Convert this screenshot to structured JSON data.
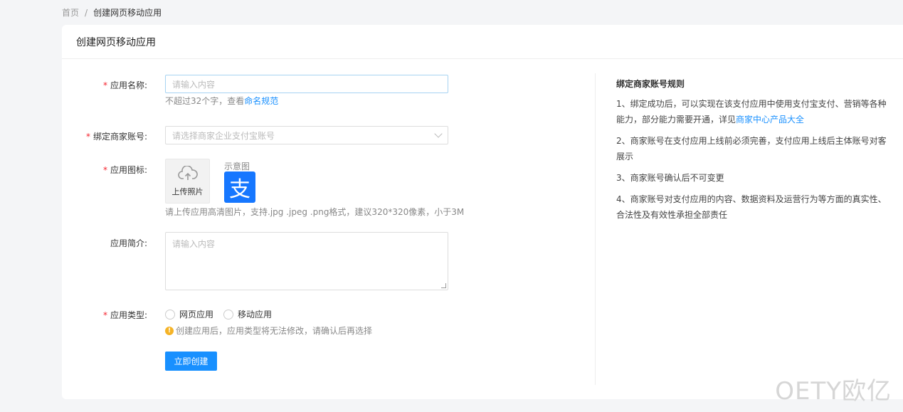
{
  "breadcrumb": {
    "home": "首页",
    "sep": "/",
    "current": "创建网页移动应用"
  },
  "card": {
    "title": "创建网页移动应用"
  },
  "form": {
    "app_name": {
      "label": "应用名称:",
      "placeholder": "请输入内容",
      "hint_prefix": "不超过32个字，查看",
      "hint_link": "命名规范"
    },
    "merchant": {
      "label": "绑定商家账号:",
      "placeholder": "请选择商家企业支付宝账号"
    },
    "icon": {
      "label": "应用图标:",
      "upload_label": "上传照片",
      "sample_label": "示意图",
      "sample_glyph": "支",
      "hint": "请上传应用高清图片，支持.jpg .jpeg .png格式，建议320*320像素，小于3M"
    },
    "intro": {
      "label": "应用简介:",
      "placeholder": "请输入内容"
    },
    "type": {
      "label": "应用类型:",
      "options": [
        "网页应用",
        "移动应用"
      ],
      "warning": "创建应用后，应用类型将无法修改，请确认后再选择"
    },
    "submit_label": "立即创建",
    "required_mark": "*"
  },
  "rules": {
    "title": "绑定商家账号规则",
    "item1_prefix": "1、绑定成功后，可以实现在该支付应用中使用支付宝支付、营销等各种能力，部分能力需要开通，详见",
    "item1_link": "商家中心产品大全",
    "item2": "2、商家账号在支付应用上线前必须完善，支付应用上线后主体账号对客展示",
    "item3": "3、商家账号确认后不可变更",
    "item4": "4、商家账号对支付应用的内容、数据资料及运营行为等方面的真实性、合法性及有效性承担全部责任"
  },
  "watermark": "OETY欧亿",
  "colors": {
    "accent": "#1890ff",
    "required": "#f5222d",
    "warning": "#f5b326",
    "alipay": "#1677ff"
  }
}
